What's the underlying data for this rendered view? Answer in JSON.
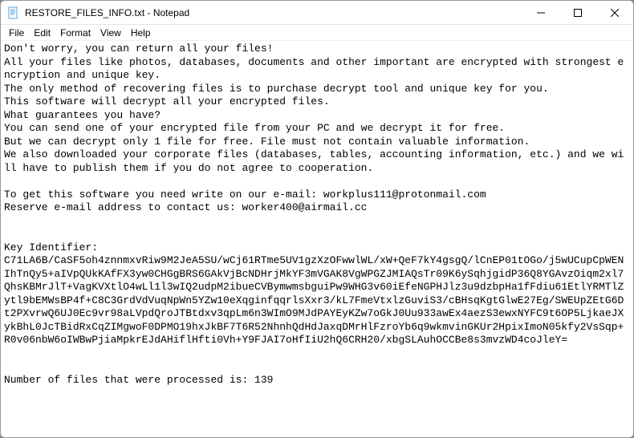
{
  "window": {
    "title": "RESTORE_FILES_INFO.txt - Notepad"
  },
  "menu": {
    "file": "File",
    "edit": "Edit",
    "format": "Format",
    "view": "View",
    "help": "Help"
  },
  "body": {
    "text": "Don't worry, you can return all your files!\nAll your files like photos, databases, documents and other important are encrypted with strongest encryption and unique key.\nThe only method of recovering files is to purchase decrypt tool and unique key for you.\nThis software will decrypt all your encrypted files.\nWhat guarantees you have?\nYou can send one of your encrypted file from your PC and we decrypt it for free.\nBut we can decrypt only 1 file for free. File must not contain valuable information.\nWe also downloaded your corporate files (databases, tables, accounting information, etc.) and we will have to publish them if you do not agree to cooperation.\n\nTo get this software you need write on our e-mail: workplus111@protonmail.com\nReserve e-mail address to contact us: worker400@airmail.cc\n\n\nKey Identifier:\nC71LA6B/CaSF5oh4znnmxvRiw9M2JeA5SU/wCj61RTme5UV1gzXzOFwwlWL/xW+QeF7kY4gsgQ/lCnEP01tOGo/j5wUCupCpWENIhTnQy5+aIVpQUkKAfFX3yw0CHGgBRS6GAkVjBcNDHrjMkYF3mVGAK8VgWPGZJMIAQsTr09K6ySqhjgidP36Q8YGAvzOiqm2xl7QhsKBMrJlT+VagKVXtlO4wLl1l3wIQ2udpM2ibueCVBymwmsbguiPw9WHG3v60iEfeNGPHJlz3u9dzbpHa1fFdiu61EtlYRMTlZytl9bEMWsBP4f+C8C3GrdVdVuqNpWn5YZw10eXqginfqqrlsXxr3/kL7FmeVtxlzGuviS3/cBHsqKgtGlwE27Eg/SWEUpZEtG6Dt2PXvrwQ6UJ0Ec9vr98aLVpdQroJTBtdxv3qpLm6n3WImO9MJdPAYEyKZw7oGkJ0Uu933awEx4aezS3ewxNYFC9t6OP5LjkaeJXykBhL0JcTBidRxCqZIMgwoF0DPMO19hxJkBF7T6R52NhnhQdHdJaxqDMrHlFzroYb6q9wkmvinGKUr2HpixImoN05kfy2VsSqp+R0v06nbW6oIWBwPjiaMpkrEJdAHiflHfti0Vh+Y9FJAI7oHfIiU2hQ6CRH20/xbgSLAuhOCCBe8s3mvzWD4coJleY=\n\n\nNumber of files that were processed is: 139"
  }
}
